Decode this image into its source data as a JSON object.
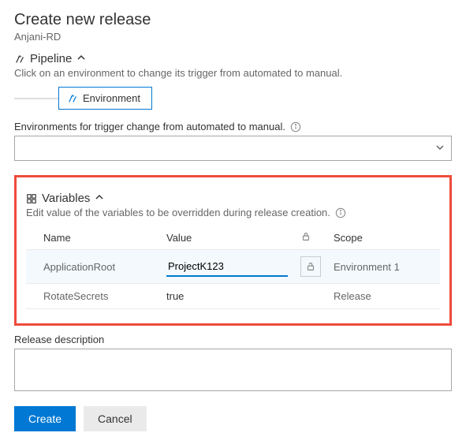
{
  "header": {
    "title": "Create new release",
    "subtitle": "Anjani-RD"
  },
  "pipeline": {
    "label": "Pipeline",
    "desc": "Click on an environment to change its trigger from automated to manual.",
    "env_box_label": "Environment"
  },
  "env_trigger": {
    "label": "Environments for trigger change from automated to manual.",
    "selected": ""
  },
  "variables": {
    "label": "Variables",
    "desc": "Edit value of the variables to be overridden during release creation.",
    "columns": {
      "name": "Name",
      "value": "Value",
      "scope": "Scope"
    },
    "rows": [
      {
        "name": "ApplicationRoot",
        "value": "ProjectK123",
        "scope": "Environment 1",
        "editing": true
      },
      {
        "name": "RotateSecrets",
        "value": "true",
        "scope": "Release",
        "editing": false
      }
    ]
  },
  "release_desc": {
    "label": "Release description",
    "value": ""
  },
  "footer": {
    "create": "Create",
    "cancel": "Cancel"
  }
}
